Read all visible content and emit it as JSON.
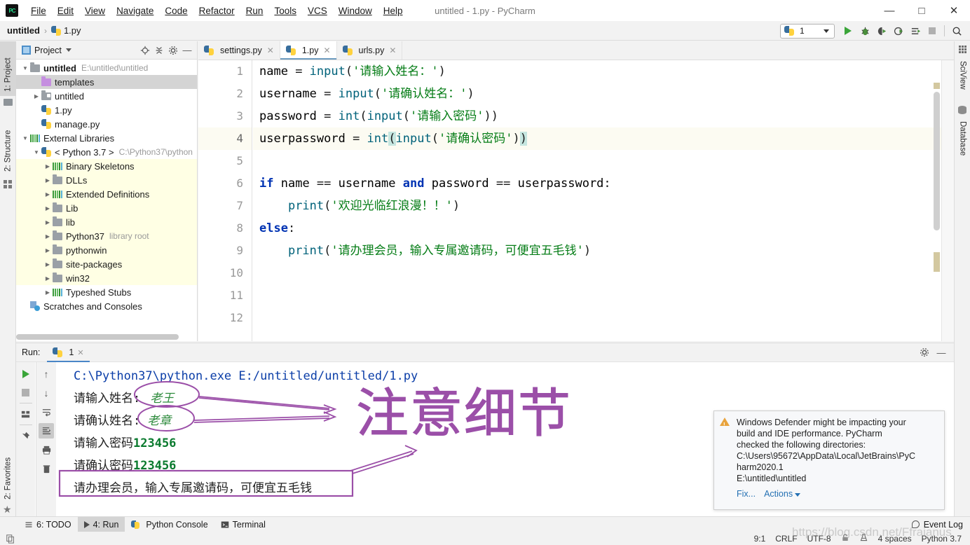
{
  "window": {
    "title": "untitled - 1.py - PyCharm",
    "logo_text": "PC",
    "controls": {
      "minimize": "—",
      "maximize": "□",
      "close": "✕"
    }
  },
  "menu": [
    {
      "label": "File"
    },
    {
      "label": "Edit"
    },
    {
      "label": "View"
    },
    {
      "label": "Navigate"
    },
    {
      "label": "Code"
    },
    {
      "label": "Refactor"
    },
    {
      "label": "Run"
    },
    {
      "label": "Tools"
    },
    {
      "label": "VCS"
    },
    {
      "label": "Window"
    },
    {
      "label": "Help"
    }
  ],
  "breadcrumb": {
    "project": "untitled",
    "separator": "›",
    "file": "1.py"
  },
  "toolbar": {
    "run_config": "1",
    "icons": [
      "run-icon",
      "debug-icon",
      "coverage-icon",
      "profile-icon",
      "run-with-params-icon",
      "stop-icon",
      "search-everywhere-icon"
    ]
  },
  "left_stripe": [
    {
      "label": "1: Project",
      "active": true,
      "icon": "folder-icon"
    },
    {
      "label": "2: Structure",
      "active": false,
      "icon": "structure-icon"
    },
    {
      "label": "2: Favorites",
      "active": false,
      "icon": "star-icon"
    }
  ],
  "right_stripe": [
    {
      "label": "SciView",
      "icon": "grid-icon"
    },
    {
      "label": "Database",
      "icon": "database-icon"
    }
  ],
  "project_panel": {
    "title": "Project",
    "header_icons": [
      "locate-icon",
      "collapse-all-icon",
      "gear-icon",
      "hide-icon"
    ],
    "tree": [
      {
        "label": "untitled",
        "sub": "E:\\untitled\\untitled",
        "indent": 0,
        "arrow": "▼",
        "icon": "folder",
        "bold": true,
        "selected": false,
        "lib": false
      },
      {
        "label": "templates",
        "sub": "",
        "indent": 1,
        "arrow": "",
        "icon": "folder-purple",
        "bold": false,
        "selected": true,
        "lib": false
      },
      {
        "label": "untitled",
        "sub": "",
        "indent": 1,
        "arrow": "▶",
        "icon": "folder-module",
        "bold": false,
        "selected": false,
        "lib": false
      },
      {
        "label": "1.py",
        "sub": "",
        "indent": 1,
        "arrow": "",
        "icon": "python-file",
        "bold": false,
        "selected": false,
        "lib": false
      },
      {
        "label": "manage.py",
        "sub": "",
        "indent": 1,
        "arrow": "",
        "icon": "python-file",
        "bold": false,
        "selected": false,
        "lib": false
      },
      {
        "label": "External Libraries",
        "sub": "",
        "indent": 0,
        "arrow": "▼",
        "icon": "bars",
        "bold": false,
        "selected": false,
        "lib": false
      },
      {
        "label": "< Python 3.7 >",
        "sub": "C:\\Python37\\python",
        "indent": 1,
        "arrow": "▼",
        "icon": "python-interp",
        "bold": false,
        "selected": false,
        "lib": false
      },
      {
        "label": "Binary Skeletons",
        "sub": "",
        "indent": 2,
        "arrow": "▶",
        "icon": "bars",
        "bold": false,
        "selected": false,
        "lib": true
      },
      {
        "label": "DLLs",
        "sub": "",
        "indent": 2,
        "arrow": "▶",
        "icon": "folder",
        "bold": false,
        "selected": false,
        "lib": true
      },
      {
        "label": "Extended Definitions",
        "sub": "",
        "indent": 2,
        "arrow": "▶",
        "icon": "bars",
        "bold": false,
        "selected": false,
        "lib": true
      },
      {
        "label": "Lib",
        "sub": "",
        "indent": 2,
        "arrow": "▶",
        "icon": "folder",
        "bold": false,
        "selected": false,
        "lib": true
      },
      {
        "label": "lib",
        "sub": "",
        "indent": 2,
        "arrow": "▶",
        "icon": "folder",
        "bold": false,
        "selected": false,
        "lib": true
      },
      {
        "label": "Python37",
        "sub": "library root",
        "indent": 2,
        "arrow": "▶",
        "icon": "folder",
        "bold": false,
        "selected": false,
        "lib": true
      },
      {
        "label": "pythonwin",
        "sub": "",
        "indent": 2,
        "arrow": "▶",
        "icon": "folder",
        "bold": false,
        "selected": false,
        "lib": true
      },
      {
        "label": "site-packages",
        "sub": "",
        "indent": 2,
        "arrow": "▶",
        "icon": "folder",
        "bold": false,
        "selected": false,
        "lib": true
      },
      {
        "label": "win32",
        "sub": "",
        "indent": 2,
        "arrow": "▶",
        "icon": "folder",
        "bold": false,
        "selected": false,
        "lib": true
      },
      {
        "label": "Typeshed Stubs",
        "sub": "",
        "indent": 2,
        "arrow": "▶",
        "icon": "bars",
        "bold": false,
        "selected": false,
        "lib": false
      },
      {
        "label": "Scratches and Consoles",
        "sub": "",
        "indent": 0,
        "arrow": "",
        "icon": "scratch",
        "bold": false,
        "selected": false,
        "lib": false
      }
    ]
  },
  "editor": {
    "tabs": [
      {
        "label": "settings.py",
        "active": false
      },
      {
        "label": "1.py",
        "active": true
      },
      {
        "label": "urls.py",
        "active": false
      }
    ],
    "line_numbers": [
      "1",
      "2",
      "3",
      "4",
      "5",
      "6",
      "7",
      "8",
      "9",
      "10",
      "11",
      "12"
    ],
    "current_line": 4,
    "lines": [
      "name = input('请输入姓名：')",
      "username = input('请确认姓名：')",
      "password = int(input('请输入密码'))",
      "userpassword = int(input('请确认密码'))",
      "",
      "if name == username and password == userpassword:",
      "    print('欢迎光临红浪漫！！')",
      "else:",
      "    print('请办理会员，输入专属邀请码，可便宜五毛钱')",
      "",
      "",
      ""
    ]
  },
  "run_panel": {
    "label": "Run:",
    "tab_label": "1",
    "side_buttons": [
      "rerun-icon",
      "stop-icon",
      "layout-icon",
      "pin-icon"
    ],
    "side_buttons2": [
      "up-arrow-icon",
      "down-arrow-icon",
      "soft-wrap-icon",
      "scroll-to-end-icon",
      "print-icon",
      "trash-icon"
    ],
    "header_icons": [
      "gear-icon",
      "hide-icon"
    ],
    "output": [
      {
        "text": "C:\\Python37\\python.exe E:/untitled/untitled/1.py",
        "style": "blue"
      },
      {
        "prompt": "请输入姓名:",
        "input": "老王",
        "style": "prompt-input"
      },
      {
        "prompt": "请确认姓名:",
        "input": "老章",
        "style": "prompt-input"
      },
      {
        "prompt": "请输入密码",
        "input": "123456",
        "style": "prompt-num"
      },
      {
        "prompt": "请确认密码",
        "input": "123456",
        "style": "prompt-num"
      },
      {
        "text": "请办理会员，输入专属邀请码，可便宜五毛钱",
        "style": "boxed"
      }
    ]
  },
  "annotation": {
    "big_text": "注意细节",
    "color": "#9b4fa8"
  },
  "notification": {
    "icon": "warning-icon",
    "lines": [
      "Windows Defender might be impacting your",
      "build and IDE performance. PyCharm",
      "checked the following directories:",
      "C:\\Users\\95672\\AppData\\Local\\JetBrains\\PyC",
      "harm2020.1",
      "E:\\untitled\\untitled"
    ],
    "fix_label": "Fix...",
    "actions_label": "Actions"
  },
  "bottom_bar": {
    "tabs": [
      {
        "label": "6: TODO",
        "icon": "todo-icon",
        "active": false
      },
      {
        "label": "4: Run",
        "icon": "run-icon",
        "active": true
      },
      {
        "label": "Python Console",
        "icon": "python-icon",
        "active": false
      },
      {
        "label": "Terminal",
        "icon": "terminal-icon",
        "active": false
      }
    ],
    "event_log": "Event Log"
  },
  "status_bar": {
    "caret": "9:1",
    "line_sep": "CRLF",
    "encoding": "UTF-8",
    "indent": "4 spaces",
    "interpreter": "Python 3.7",
    "lock_icon": "lock-icon",
    "inspection_icon": "inspections-icon"
  },
  "watermark": "https://blog.csdn.net/Ffraianus"
}
